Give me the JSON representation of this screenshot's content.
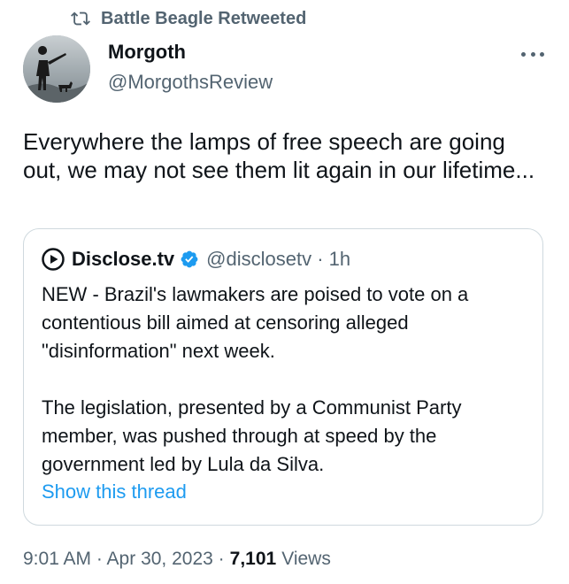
{
  "retweet": {
    "icon": "retweet-icon",
    "text": "Battle Beagle Retweeted"
  },
  "author": {
    "name": "Morgoth",
    "handle": "@MorgothsReview",
    "avatar_icon": "avatar-silhouette"
  },
  "more_icon": "more-icon",
  "tweet": {
    "text": "Everywhere the lamps of free speech are going out, we may not see them lit again in our lifetime..."
  },
  "quote": {
    "logo_icon": "disclose-logo-icon",
    "name": "Disclose.tv",
    "verified_icon": "verified-badge-icon",
    "handle_time": "@disclosetv · 1h",
    "body": "NEW - Brazil's lawmakers are poised to vote on a contentious bill aimed at censoring alleged \"disinformation\" next week.\n\nThe legislation, presented by a Communist Party member, was pushed through at speed by the government led by Lula da Silva.",
    "show_thread": "Show this thread"
  },
  "meta": {
    "time_date": "9:01 AM · Apr 30, 2023 ·",
    "views_count": "7,101",
    "views_label": "Views"
  },
  "colors": {
    "text": "#0f1419",
    "secondary": "#536471",
    "link": "#1d9bf0",
    "verified": "#1d9bf0",
    "border": "#cfd9de"
  }
}
